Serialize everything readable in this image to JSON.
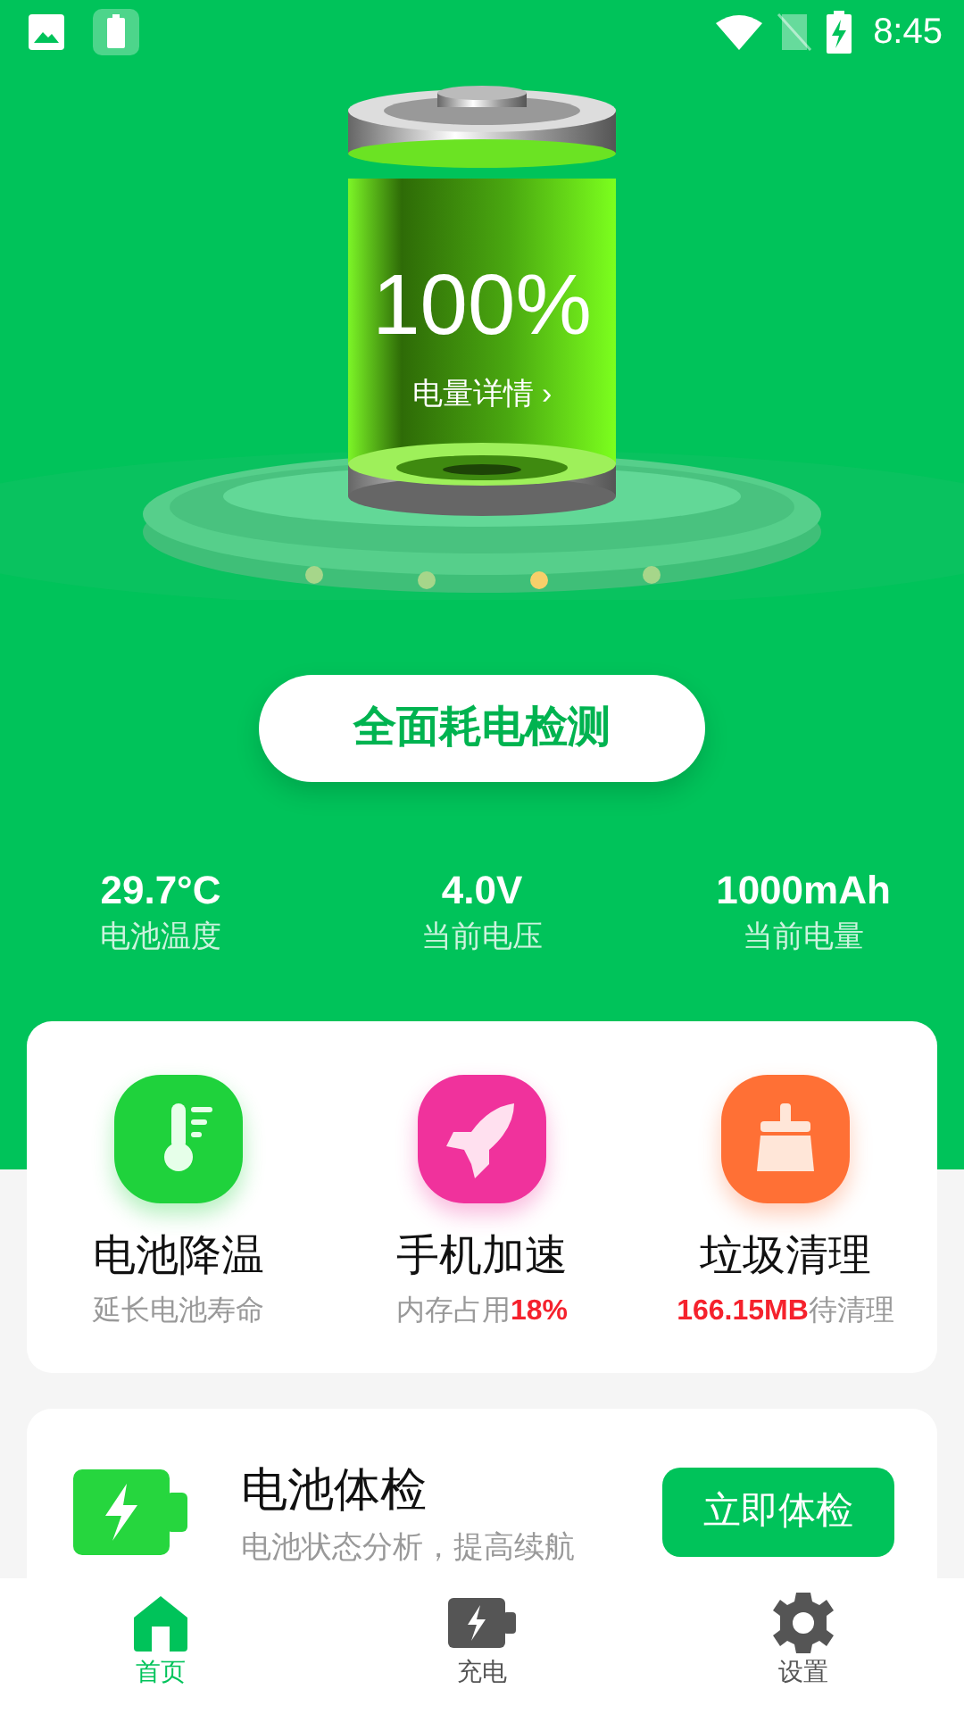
{
  "status_bar": {
    "time": "8:45"
  },
  "battery": {
    "percent": "100%",
    "details_link": "电量详情 ›"
  },
  "scan_button": "全面耗电检测",
  "stats": [
    {
      "value": "29.7°C",
      "label": "电池温度"
    },
    {
      "value": "4.0V",
      "label": "当前电压"
    },
    {
      "value": "1000mAh",
      "label": "当前电量"
    }
  ],
  "features": [
    {
      "kind": "thermometer",
      "color": "#1fd23c",
      "title": "电池降温",
      "subtitle": "延长电池寿命"
    },
    {
      "kind": "rocket",
      "color": "#f0329c",
      "title": "手机加速",
      "subtitle": "内存占用**18%**"
    },
    {
      "kind": "broom",
      "color": "#ff7035",
      "title": "垃圾清理",
      "subtitle": "**166.15MB**待清理"
    }
  ],
  "checkup": {
    "title": "电池体检",
    "subtitle": "电池状态分析，提高续航",
    "button": "立即体检"
  },
  "bottom_nav": [
    {
      "kind": "home",
      "label": "首页",
      "selected": true
    },
    {
      "kind": "charge",
      "label": "充电",
      "selected": false
    },
    {
      "kind": "settings",
      "label": "设置",
      "selected": false
    }
  ]
}
